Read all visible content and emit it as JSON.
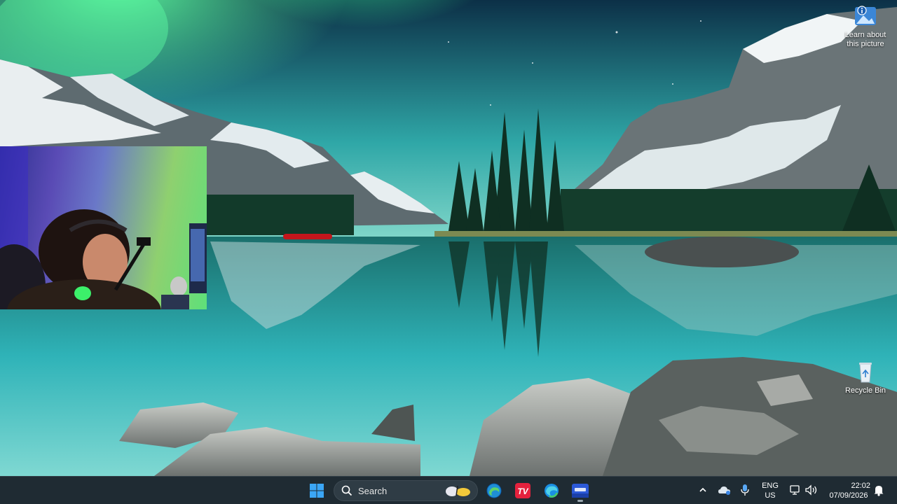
{
  "desktop": {
    "icons": [
      {
        "label": "Learn about this picture",
        "icon": "learn-about-picture-icon"
      },
      {
        "label": "Recycle Bin",
        "icon": "recycle-bin-icon"
      }
    ]
  },
  "webcam_overlay": {
    "content": "streamer webcam feed"
  },
  "taskbar": {
    "start_icon": "windows-start-icon",
    "search_placeholder": "Search",
    "pinned_apps": [
      {
        "icon": "edge-beta-icon"
      },
      {
        "icon": "tradingview-icon"
      },
      {
        "icon": "edge-icon"
      },
      {
        "icon": "video-editor-icon",
        "active": true
      }
    ],
    "tray": {
      "language": "ENG",
      "region": "US",
      "time": "22:02",
      "date": "07/09/2026"
    }
  },
  "colors": {
    "taskbar_bg": "#1f2b33",
    "aurora": "#3cf59a",
    "lake": "#2fb3b8"
  }
}
